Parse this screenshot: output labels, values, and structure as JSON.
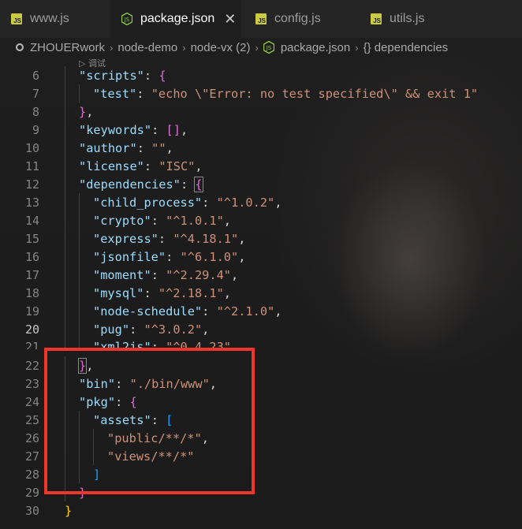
{
  "tabs": [
    {
      "label": "www.js",
      "icon": "js-icon",
      "active": false
    },
    {
      "label": "package.json",
      "icon": "nodejs-icon",
      "active": true
    },
    {
      "label": "config.js",
      "icon": "js-icon",
      "active": false
    },
    {
      "label": "utils.js",
      "icon": "js-icon",
      "active": false
    }
  ],
  "tab_close_glyph": "✕",
  "js_badge": "JS",
  "breadcrumb": {
    "root": "ZHOUERwork",
    "items": [
      "node-demo",
      "node-vx (2)",
      "package.json",
      "{} dependencies"
    ],
    "separator": "›"
  },
  "codelens": "▷ 调试",
  "lines": [
    {
      "n": "6"
    },
    {
      "n": "7"
    },
    {
      "n": "8"
    },
    {
      "n": "9"
    },
    {
      "n": "10"
    },
    {
      "n": "11"
    },
    {
      "n": "12"
    },
    {
      "n": "13"
    },
    {
      "n": "14"
    },
    {
      "n": "15"
    },
    {
      "n": "16"
    },
    {
      "n": "17"
    },
    {
      "n": "18"
    },
    {
      "n": "19"
    },
    {
      "n": "20"
    },
    {
      "n": "21"
    },
    {
      "n": "22"
    },
    {
      "n": "23"
    },
    {
      "n": "24"
    },
    {
      "n": "25"
    },
    {
      "n": "26"
    },
    {
      "n": "27"
    },
    {
      "n": "28"
    },
    {
      "n": "29"
    },
    {
      "n": "30"
    }
  ],
  "code": {
    "scripts_key": "\"scripts\"",
    "test_key": "\"test\"",
    "test_val": "\"echo \\\"Error: no test specified\\\" && exit 1\"",
    "keywords_key": "\"keywords\"",
    "author_key": "\"author\"",
    "author_val": "\"\"",
    "license_key": "\"license\"",
    "license_val": "\"ISC\"",
    "deps_key": "\"dependencies\"",
    "deps": [
      {
        "k": "\"child_process\"",
        "v": "\"^1.0.2\""
      },
      {
        "k": "\"crypto\"",
        "v": "\"^1.0.1\""
      },
      {
        "k": "\"express\"",
        "v": "\"^4.18.1\""
      },
      {
        "k": "\"jsonfile\"",
        "v": "\"^6.1.0\""
      },
      {
        "k": "\"moment\"",
        "v": "\"^2.29.4\""
      },
      {
        "k": "\"mysql\"",
        "v": "\"^2.18.1\""
      },
      {
        "k": "\"node-schedule\"",
        "v": "\"^2.1.0\""
      },
      {
        "k": "\"pug\"",
        "v": "\"^3.0.2\""
      },
      {
        "k": "\"xml2js\"",
        "v": "\"^0.4.23\""
      }
    ],
    "bin_key": "\"bin\"",
    "bin_val": "\"./bin/www\"",
    "pkg_key": "\"pkg\"",
    "assets_key": "\"assets\"",
    "asset1": "\"public/**/*\"",
    "asset2": "\"views/**/*\""
  },
  "current_line": "20",
  "colors": {
    "highlight_box": "#f0352b",
    "string": "#ce9178",
    "key": "#9cdcfe"
  }
}
